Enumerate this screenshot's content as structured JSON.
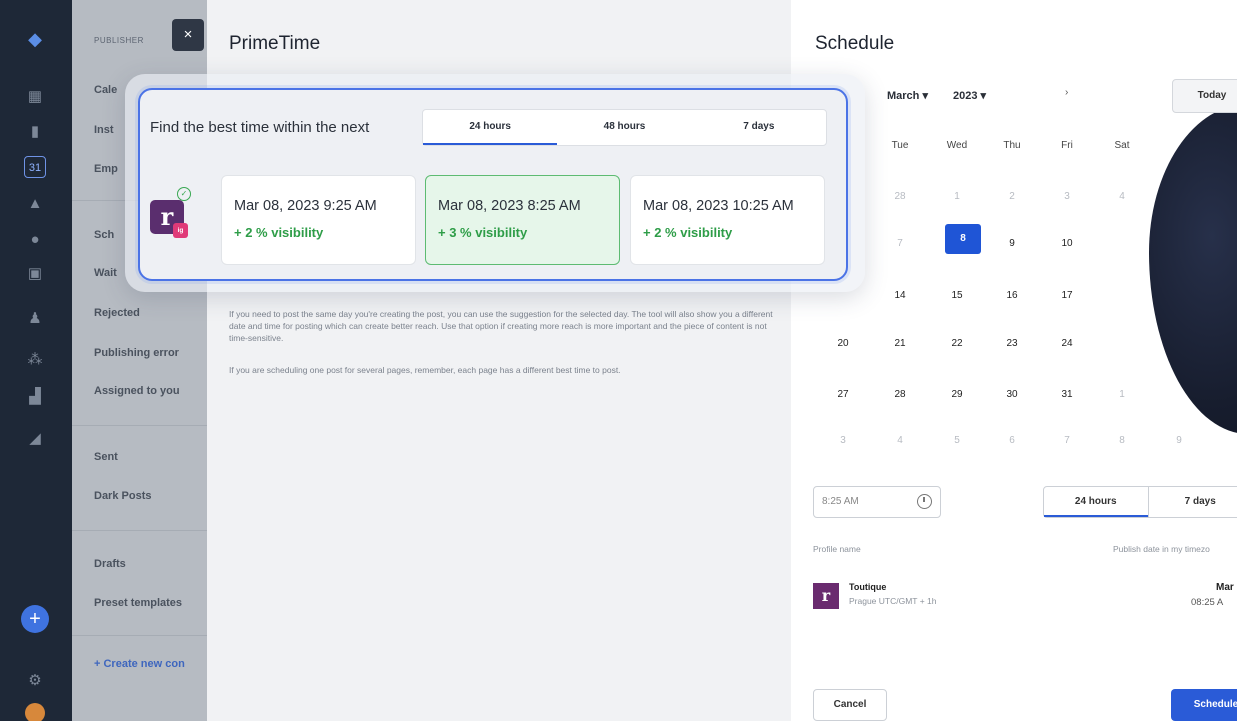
{
  "sidebar": {
    "title": "PUBLISHER",
    "items": [
      {
        "label": "Cale"
      },
      {
        "label": "Inst"
      },
      {
        "label": "Emp"
      },
      {
        "label": "Sch"
      },
      {
        "label": "Wait"
      },
      {
        "label": "Rejected"
      },
      {
        "label": "Publishing error"
      },
      {
        "label": "Assigned to you"
      },
      {
        "label": "Sent"
      },
      {
        "label": "Dark Posts"
      },
      {
        "label": "Drafts"
      },
      {
        "label": "Preset templates"
      }
    ],
    "create_label": "+ Create new con",
    "close_label": "×"
  },
  "primetime": {
    "title": "PrimeTime",
    "text1": "If you need to post the same day you're creating the post, you can use the suggestion for the selected day. The tool will also show you a different date and time for posting which can create better reach. Use that option if creating more reach is more important and the piece of content is not time-sensitive.",
    "text2": "If you are scheduling one post for several pages, remember, each page has a different best time to post."
  },
  "best_time": {
    "label": "Find the best time within the next",
    "tabs": [
      {
        "label": "24 hours"
      },
      {
        "label": "48 hours"
      },
      {
        "label": "7 days"
      }
    ],
    "profile_letter": "r",
    "network_badge": "ig",
    "slots": [
      {
        "date": "Mar 08, 2023 9:25 AM",
        "visibility": "+ 2 % visibility"
      },
      {
        "date": "Mar 08, 2023 8:25 AM",
        "visibility": "+ 3 % visibility"
      },
      {
        "date": "Mar 08, 2023 10:25 AM",
        "visibility": "+ 2 % visibility"
      }
    ]
  },
  "schedule": {
    "title": "Schedule",
    "month": "March ▾",
    "year": "2023 ▾",
    "next": "›",
    "today_label": "Today",
    "weekdays": [
      "Tue",
      "Wed",
      "Thu",
      "Fri",
      "Sat"
    ],
    "weeks": [
      [
        "",
        "28",
        "1",
        "2",
        "3",
        "4"
      ],
      [
        "",
        "7",
        "8",
        "9",
        "10",
        ""
      ],
      [
        "",
        "14",
        "15",
        "16",
        "17",
        ""
      ],
      [
        "20",
        "21",
        "22",
        "23",
        "24",
        ""
      ],
      [
        "27",
        "28",
        "29",
        "30",
        "31",
        "1"
      ],
      [
        "3",
        "4",
        "5",
        "6",
        "7",
        "8",
        "9"
      ]
    ],
    "time_value": "8:25 AM",
    "range_tabs": [
      {
        "label": "24 hours"
      },
      {
        "label": "7 days"
      }
    ],
    "col_profile": "Profile name",
    "col_publish": "Publish date in my timezo",
    "profile_name": "Toutique",
    "profile_tz": "Prague UTC/GMT + 1h",
    "publish_date": "Mar",
    "publish_time": "08:25 A",
    "cancel_label": "Cancel",
    "schedule_label": "Schedule"
  }
}
